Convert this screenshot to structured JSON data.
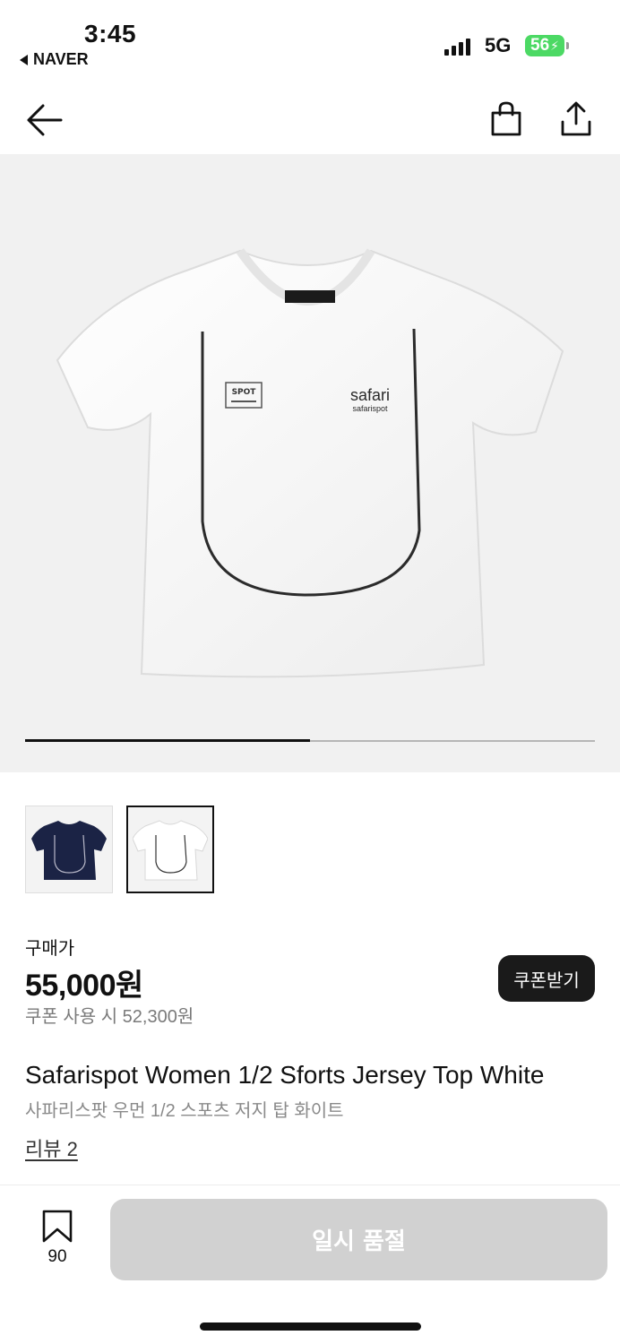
{
  "status_bar": {
    "time": "3:45",
    "back_app": "NAVER",
    "network": "5G",
    "battery": "56"
  },
  "nav": {
    "back_icon": "arrow-left-icon",
    "bag_icon": "shopping-bag-icon",
    "share_icon": "share-icon"
  },
  "gallery": {
    "progress": 0.5,
    "main_image": {
      "brand_text": "safari",
      "brand_subtext": "safarispot",
      "patch_text": "SPOT"
    },
    "thumbnails": [
      {
        "color": "#1b2345",
        "selected": false
      },
      {
        "color": "#ededed",
        "selected": true
      }
    ]
  },
  "price": {
    "label": "구매가",
    "value": "55,000원",
    "coupon_price": "쿠폰 사용 시 52,300원",
    "coupon_button": "쿠폰받기"
  },
  "product": {
    "title_en": "Safarispot Women 1/2 Sforts Jersey Top White",
    "title_ko": "사파리스팟 우먼 1/2 스포츠 저지 탑 화이트",
    "review_link": "리뷰 2"
  },
  "bottom_bar": {
    "bookmark_count": "90",
    "soldout_label": "일시 품절"
  },
  "colors": {
    "accent": "#1a1a1a",
    "battery": "#4cd964",
    "disabled": "#d1d1d1",
    "hero_bg": "#f1f1f1"
  }
}
